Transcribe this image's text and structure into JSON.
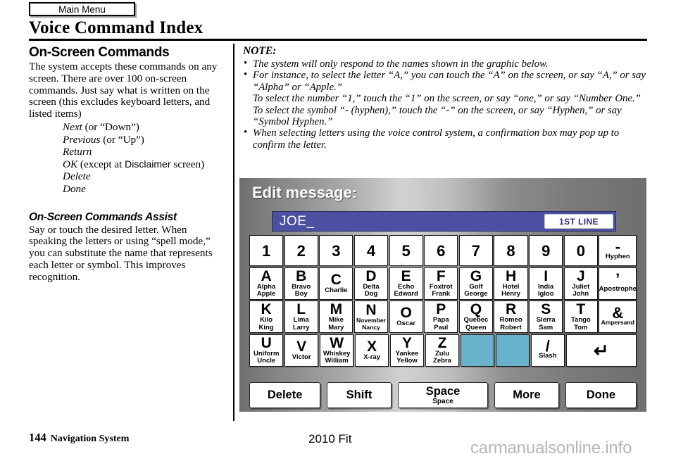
{
  "header": {
    "main_menu_tab": "Main Menu",
    "page_title": "Voice Command Index"
  },
  "left_column": {
    "section1": {
      "heading": "On-Screen Commands",
      "paragraph": "The system accepts these commands on any screen. There are over 100 on-screen commands. Just say what is written on the screen (this excludes keyboard letters, and listed items)",
      "commands": [
        {
          "name": "Next",
          "suffix": " (or “Down”)"
        },
        {
          "name": "Previous",
          "suffix": " (or “Up”)"
        },
        {
          "name": "Return",
          "suffix": ""
        },
        {
          "name": "OK",
          "suffix": " (except at ",
          "sans": "Disclaimer",
          "suffix2": " screen)"
        },
        {
          "name": "Delete",
          "suffix": ""
        },
        {
          "name": "Done",
          "suffix": ""
        }
      ]
    },
    "section2": {
      "heading": "On-Screen Commands Assist",
      "paragraph": "Say or touch the desired letter. When speaking the letters or using “spell mode,” you can substitute the name that represents each letter or symbol. This improves recognition."
    }
  },
  "note": {
    "label": "NOTE:",
    "items": [
      "The system will only respond to the names shown in the graphic below.",
      "For instance, to select the letter “A,” you can touch the “A” on the screen, or say “A,” or say “Alpha” or “Apple.”"
    ],
    "sub_lines": [
      "To select the number “1,” touch the “1” on the screen, or say “one,” or say “Number One.”",
      "To select the symbol “- (hyphen),” touch the “-” on the screen, or say “Hyphen,” or say “Symbol Hyphen.”"
    ],
    "last_item": "When selecting letters using the voice control system, a confirmation box may pop up to confirm the letter."
  },
  "keyboard": {
    "title": "Edit message:",
    "input_value": "JOE_",
    "line_badge": "1ST LINE",
    "colors": {
      "input_background": "#4b51a0",
      "badge_text": "#2b2f7a",
      "disabled_key": "#68b2cb"
    },
    "rows": [
      [
        {
          "glyph": "1",
          "names": []
        },
        {
          "glyph": "2",
          "names": []
        },
        {
          "glyph": "3",
          "names": []
        },
        {
          "glyph": "4",
          "names": []
        },
        {
          "glyph": "5",
          "names": []
        },
        {
          "glyph": "6",
          "names": []
        },
        {
          "glyph": "7",
          "names": []
        },
        {
          "glyph": "8",
          "names": []
        },
        {
          "glyph": "9",
          "names": []
        },
        {
          "glyph": "0",
          "names": []
        },
        {
          "glyph": "-",
          "names": [
            "Hyphen"
          ],
          "wide": true,
          "symbol": true
        }
      ],
      [
        {
          "glyph": "A",
          "names": [
            "Alpha",
            "Apple"
          ]
        },
        {
          "glyph": "B",
          "names": [
            "Bravo",
            "Boy"
          ]
        },
        {
          "glyph": "C",
          "names": [
            "Charlie"
          ]
        },
        {
          "glyph": "D",
          "names": [
            "Delta",
            "Dog"
          ]
        },
        {
          "glyph": "E",
          "names": [
            "Echo",
            "Edward"
          ]
        },
        {
          "glyph": "F",
          "names": [
            "Foxtrot",
            "Frank"
          ]
        },
        {
          "glyph": "G",
          "names": [
            "Golf",
            "George"
          ]
        },
        {
          "glyph": "H",
          "names": [
            "Hotel",
            "Henry"
          ]
        },
        {
          "glyph": "I",
          "names": [
            "India",
            "Igloo"
          ]
        },
        {
          "glyph": "J",
          "names": [
            "Juliet",
            "John"
          ]
        },
        {
          "glyph": "’",
          "names": [
            "Apostrophe"
          ],
          "wide": true,
          "symbol": true
        }
      ],
      [
        {
          "glyph": "K",
          "names": [
            "Kilo",
            "King"
          ]
        },
        {
          "glyph": "L",
          "names": [
            "Lima",
            "Larry"
          ]
        },
        {
          "glyph": "M",
          "names": [
            "Mike",
            "Mary"
          ]
        },
        {
          "glyph": "N",
          "names": [
            "November",
            "Nancy"
          ],
          "small": true
        },
        {
          "glyph": "O",
          "names": [
            "Oscar"
          ]
        },
        {
          "glyph": "P",
          "names": [
            "Papa",
            "Paul"
          ]
        },
        {
          "glyph": "Q",
          "names": [
            "Quebec",
            "Queen"
          ]
        },
        {
          "glyph": "R",
          "names": [
            "Romeo",
            "Robert"
          ]
        },
        {
          "glyph": "S",
          "names": [
            "Sierra",
            "Sam"
          ]
        },
        {
          "glyph": "T",
          "names": [
            "Tango",
            "Tom"
          ]
        },
        {
          "glyph": "&",
          "names": [
            "Ampersand"
          ],
          "wide": true,
          "symbol": true,
          "small": true
        }
      ],
      [
        {
          "glyph": "U",
          "names": [
            "Uniform",
            "Uncle"
          ]
        },
        {
          "glyph": "V",
          "names": [
            "Victor"
          ]
        },
        {
          "glyph": "W",
          "names": [
            "Whiskey",
            "William"
          ]
        },
        {
          "glyph": "X",
          "names": [
            "X-ray"
          ]
        },
        {
          "glyph": "Y",
          "names": [
            "Yankee",
            "Yellow"
          ]
        },
        {
          "glyph": "Z",
          "names": [
            "Zulu",
            "Zebra"
          ]
        },
        {
          "glyph": "",
          "names": [],
          "blank": true
        },
        {
          "glyph": "",
          "names": [],
          "blank": true
        },
        {
          "glyph": "/",
          "names": [
            "Slash"
          ],
          "symbol": true
        },
        {
          "glyph": "↵",
          "names": [],
          "enter": true,
          "span": 2
        }
      ]
    ],
    "actions": [
      {
        "label": "Delete",
        "sub": ""
      },
      {
        "label": "Shift",
        "sub": ""
      },
      {
        "label": "Space",
        "sub": "Space"
      },
      {
        "label": "More",
        "sub": ""
      },
      {
        "label": "Done",
        "sub": ""
      }
    ]
  },
  "footer": {
    "page_number": "144",
    "section": "Navigation System",
    "model_year": "2010 Fit",
    "watermark": "carmanualsonline.info"
  }
}
